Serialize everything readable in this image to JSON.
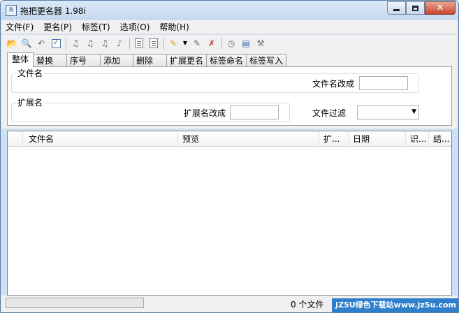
{
  "window": {
    "title": "拖把更名器 1.98i",
    "icon_name": "app-icon"
  },
  "menu": [
    "文件(F)",
    "更名(P)",
    "标签(T)",
    "选项(O)",
    "帮助(H)"
  ],
  "toolbar_icons": [
    "open-folder-icon",
    "search-icon",
    "undo-icon",
    "checklist-icon",
    "music-tag-icon-1",
    "music-tag-icon-2",
    "music-tag-icon-3",
    "music-tag-icon-4",
    "text-file-icon-1",
    "text-file-icon-2",
    "pencil-icon",
    "dropdown-arrow-icon",
    "edit-file-icon",
    "delete-file-icon",
    "clock-icon",
    "panel-icon",
    "tools-icon"
  ],
  "tabs": [
    "整体",
    "替换",
    "序号",
    "添加",
    "删除",
    "扩展更名",
    "标签命名",
    "标签写入"
  ],
  "active_tab": "整体",
  "panel": {
    "filename_group": "文件名",
    "filename_change_label": "文件名改成",
    "filename_change_value": "",
    "ext_group": "扩展名",
    "ext_change_label": "扩展名改成",
    "ext_change_value": "",
    "filter_label": "文件过滤",
    "filter_value": ""
  },
  "list_columns": [
    "文件名",
    "预览",
    "扩...",
    "日期",
    "识...",
    "结..."
  ],
  "status": {
    "progress": 0,
    "file_count": "0 个文件"
  },
  "watermark": "JZ5U绿色下载站www.jz5u.com"
}
